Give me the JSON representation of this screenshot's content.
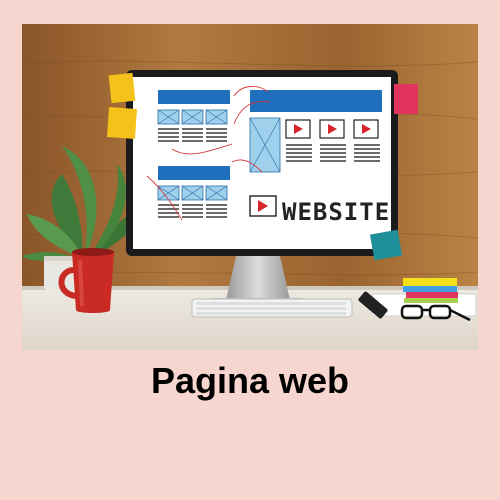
{
  "scene": {
    "description_colors": {
      "background": "#f7d6d0",
      "wood": "#a36a34",
      "desk": "#e9e4dc",
      "accent_blue": "#1f6fbf",
      "play_red": "#d8242b",
      "mug_red": "#c92a23",
      "sticky_yellow": "#f4c21a",
      "sticky_pink": "#e0335e",
      "sticky_teal": "#1f8f99"
    },
    "screen_word": "WEBSITE"
  },
  "caption": {
    "text": "Pagina web"
  }
}
